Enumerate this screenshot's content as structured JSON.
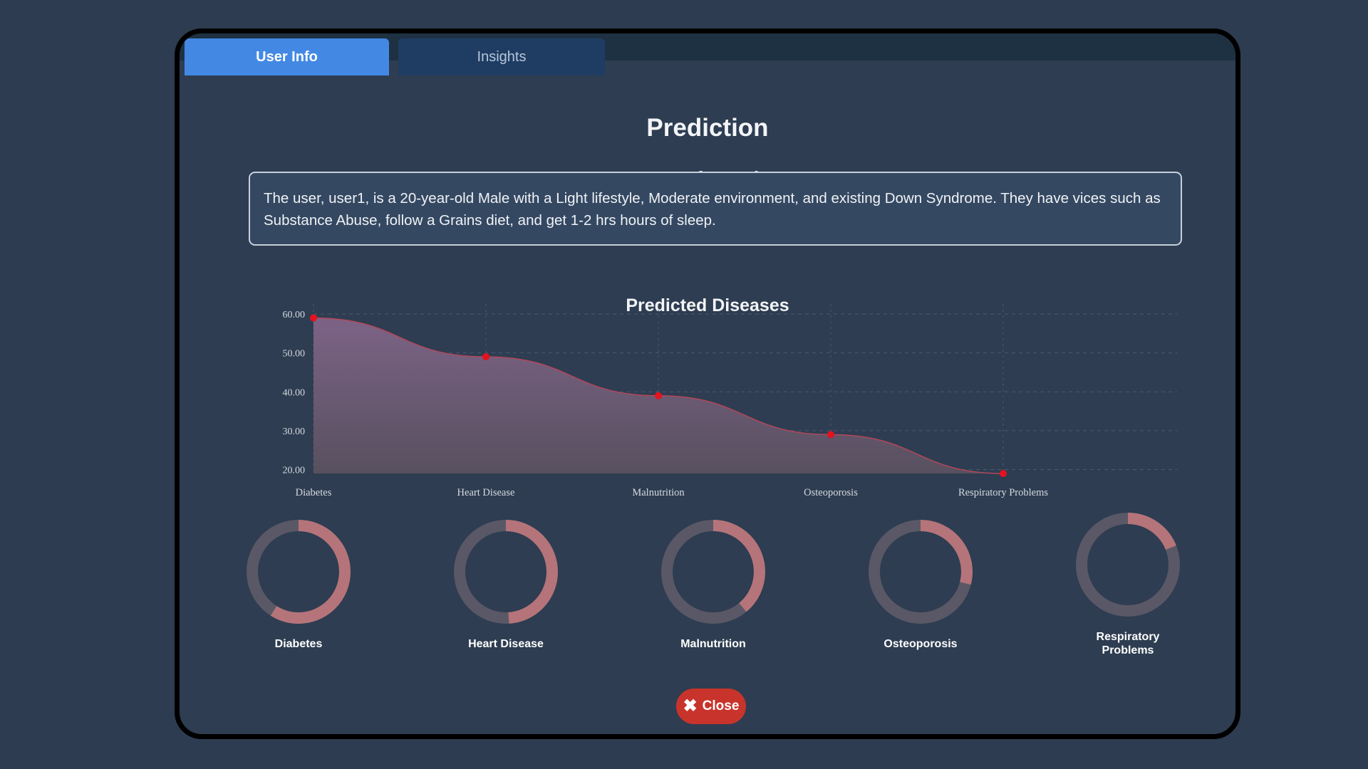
{
  "tabs": [
    {
      "label": "User Info",
      "active": true
    },
    {
      "label": "Insights",
      "active": false
    }
  ],
  "title": "Prediction",
  "user_section": {
    "heading": "User Information",
    "description": "The user, user1, is a 20-year-old Male with a Light lifestyle, Moderate environment, and existing Down Syndrome. They have vices such as Substance Abuse, follow a Grains diet, and get 1-2 hrs hours of sleep."
  },
  "chart_heading": "Predicted Diseases",
  "chart_data": {
    "type": "area",
    "title": "Predicted Diseases",
    "categories": [
      "Diabetes",
      "Heart Disease",
      "Malnutrition",
      "Osteoporosis",
      "Respiratory Problems"
    ],
    "values": [
      59,
      49,
      39,
      29,
      19
    ],
    "ylim": [
      19,
      60
    ],
    "yticks": [
      "60.00",
      "50.00",
      "40.00",
      "30.00",
      "20.00"
    ],
    "ytick_values": [
      60,
      50,
      40,
      30,
      20
    ],
    "grid": true,
    "colors": {
      "line": "#b2475a",
      "point": "#e5121f",
      "fill_top": "#7c6386",
      "fill_bottom": "#58505f"
    }
  },
  "donuts": [
    {
      "label": "Diabetes",
      "fraction": 0.59
    },
    {
      "label": "Heart Disease",
      "fraction": 0.49
    },
    {
      "label": "Malnutrition",
      "fraction": 0.39
    },
    {
      "label": "Osteoporosis",
      "fraction": 0.29
    },
    {
      "label": "Respiratory Problems",
      "fraction": 0.19
    }
  ],
  "donut_colors": {
    "arc": "#b5747a",
    "track": "#5a5866"
  },
  "close_button": {
    "label": "Close",
    "icon": "close-icon"
  }
}
